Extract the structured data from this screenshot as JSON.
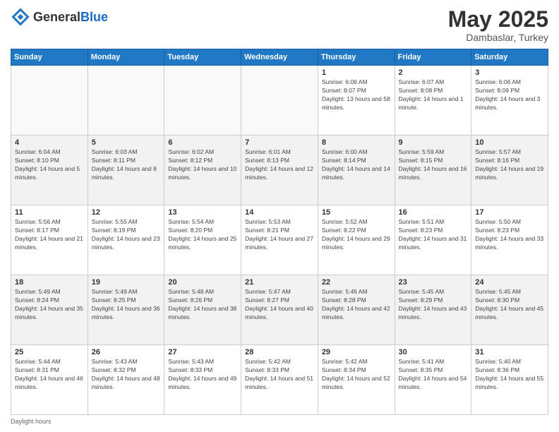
{
  "logo": {
    "general": "General",
    "blue": "Blue"
  },
  "title": {
    "month": "May 2025",
    "location": "Dambaslar, Turkey"
  },
  "days_of_week": [
    "Sunday",
    "Monday",
    "Tuesday",
    "Wednesday",
    "Thursday",
    "Friday",
    "Saturday"
  ],
  "weeks": [
    [
      {
        "day": "",
        "sunrise": "",
        "sunset": "",
        "daylight": "",
        "empty": true
      },
      {
        "day": "",
        "sunrise": "",
        "sunset": "",
        "daylight": "",
        "empty": true
      },
      {
        "day": "",
        "sunrise": "",
        "sunset": "",
        "daylight": "",
        "empty": true
      },
      {
        "day": "",
        "sunrise": "",
        "sunset": "",
        "daylight": "",
        "empty": true
      },
      {
        "day": "1",
        "sunrise": "6:08 AM",
        "sunset": "8:07 PM",
        "daylight": "13 hours and 58 minutes."
      },
      {
        "day": "2",
        "sunrise": "6:07 AM",
        "sunset": "8:08 PM",
        "daylight": "14 hours and 1 minute."
      },
      {
        "day": "3",
        "sunrise": "6:06 AM",
        "sunset": "8:09 PM",
        "daylight": "14 hours and 3 minutes."
      }
    ],
    [
      {
        "day": "4",
        "sunrise": "6:04 AM",
        "sunset": "8:10 PM",
        "daylight": "14 hours and 5 minutes."
      },
      {
        "day": "5",
        "sunrise": "6:03 AM",
        "sunset": "8:11 PM",
        "daylight": "14 hours and 8 minutes."
      },
      {
        "day": "6",
        "sunrise": "6:02 AM",
        "sunset": "8:12 PM",
        "daylight": "14 hours and 10 minutes."
      },
      {
        "day": "7",
        "sunrise": "6:01 AM",
        "sunset": "8:13 PM",
        "daylight": "14 hours and 12 minutes."
      },
      {
        "day": "8",
        "sunrise": "6:00 AM",
        "sunset": "8:14 PM",
        "daylight": "14 hours and 14 minutes."
      },
      {
        "day": "9",
        "sunrise": "5:59 AM",
        "sunset": "8:15 PM",
        "daylight": "14 hours and 16 minutes."
      },
      {
        "day": "10",
        "sunrise": "5:57 AM",
        "sunset": "8:16 PM",
        "daylight": "14 hours and 19 minutes."
      }
    ],
    [
      {
        "day": "11",
        "sunrise": "5:56 AM",
        "sunset": "8:17 PM",
        "daylight": "14 hours and 21 minutes."
      },
      {
        "day": "12",
        "sunrise": "5:55 AM",
        "sunset": "8:19 PM",
        "daylight": "14 hours and 23 minutes."
      },
      {
        "day": "13",
        "sunrise": "5:54 AM",
        "sunset": "8:20 PM",
        "daylight": "14 hours and 25 minutes."
      },
      {
        "day": "14",
        "sunrise": "5:53 AM",
        "sunset": "8:21 PM",
        "daylight": "14 hours and 27 minutes."
      },
      {
        "day": "15",
        "sunrise": "5:52 AM",
        "sunset": "8:22 PM",
        "daylight": "14 hours and 29 minutes."
      },
      {
        "day": "16",
        "sunrise": "5:51 AM",
        "sunset": "8:23 PM",
        "daylight": "14 hours and 31 minutes."
      },
      {
        "day": "17",
        "sunrise": "5:50 AM",
        "sunset": "8:23 PM",
        "daylight": "14 hours and 33 minutes."
      }
    ],
    [
      {
        "day": "18",
        "sunrise": "5:49 AM",
        "sunset": "8:24 PM",
        "daylight": "14 hours and 35 minutes."
      },
      {
        "day": "19",
        "sunrise": "5:49 AM",
        "sunset": "8:25 PM",
        "daylight": "14 hours and 36 minutes."
      },
      {
        "day": "20",
        "sunrise": "5:48 AM",
        "sunset": "8:26 PM",
        "daylight": "14 hours and 38 minutes."
      },
      {
        "day": "21",
        "sunrise": "5:47 AM",
        "sunset": "8:27 PM",
        "daylight": "14 hours and 40 minutes."
      },
      {
        "day": "22",
        "sunrise": "5:46 AM",
        "sunset": "8:28 PM",
        "daylight": "14 hours and 42 minutes."
      },
      {
        "day": "23",
        "sunrise": "5:45 AM",
        "sunset": "8:29 PM",
        "daylight": "14 hours and 43 minutes."
      },
      {
        "day": "24",
        "sunrise": "5:45 AM",
        "sunset": "8:30 PM",
        "daylight": "14 hours and 45 minutes."
      }
    ],
    [
      {
        "day": "25",
        "sunrise": "5:44 AM",
        "sunset": "8:31 PM",
        "daylight": "14 hours and 46 minutes."
      },
      {
        "day": "26",
        "sunrise": "5:43 AM",
        "sunset": "8:32 PM",
        "daylight": "14 hours and 48 minutes."
      },
      {
        "day": "27",
        "sunrise": "5:43 AM",
        "sunset": "8:33 PM",
        "daylight": "14 hours and 49 minutes."
      },
      {
        "day": "28",
        "sunrise": "5:42 AM",
        "sunset": "8:33 PM",
        "daylight": "14 hours and 51 minutes."
      },
      {
        "day": "29",
        "sunrise": "5:42 AM",
        "sunset": "8:34 PM",
        "daylight": "14 hours and 52 minutes."
      },
      {
        "day": "30",
        "sunrise": "5:41 AM",
        "sunset": "8:35 PM",
        "daylight": "14 hours and 54 minutes."
      },
      {
        "day": "31",
        "sunrise": "5:40 AM",
        "sunset": "8:36 PM",
        "daylight": "14 hours and 55 minutes."
      }
    ]
  ],
  "footer": {
    "note": "Daylight hours"
  }
}
